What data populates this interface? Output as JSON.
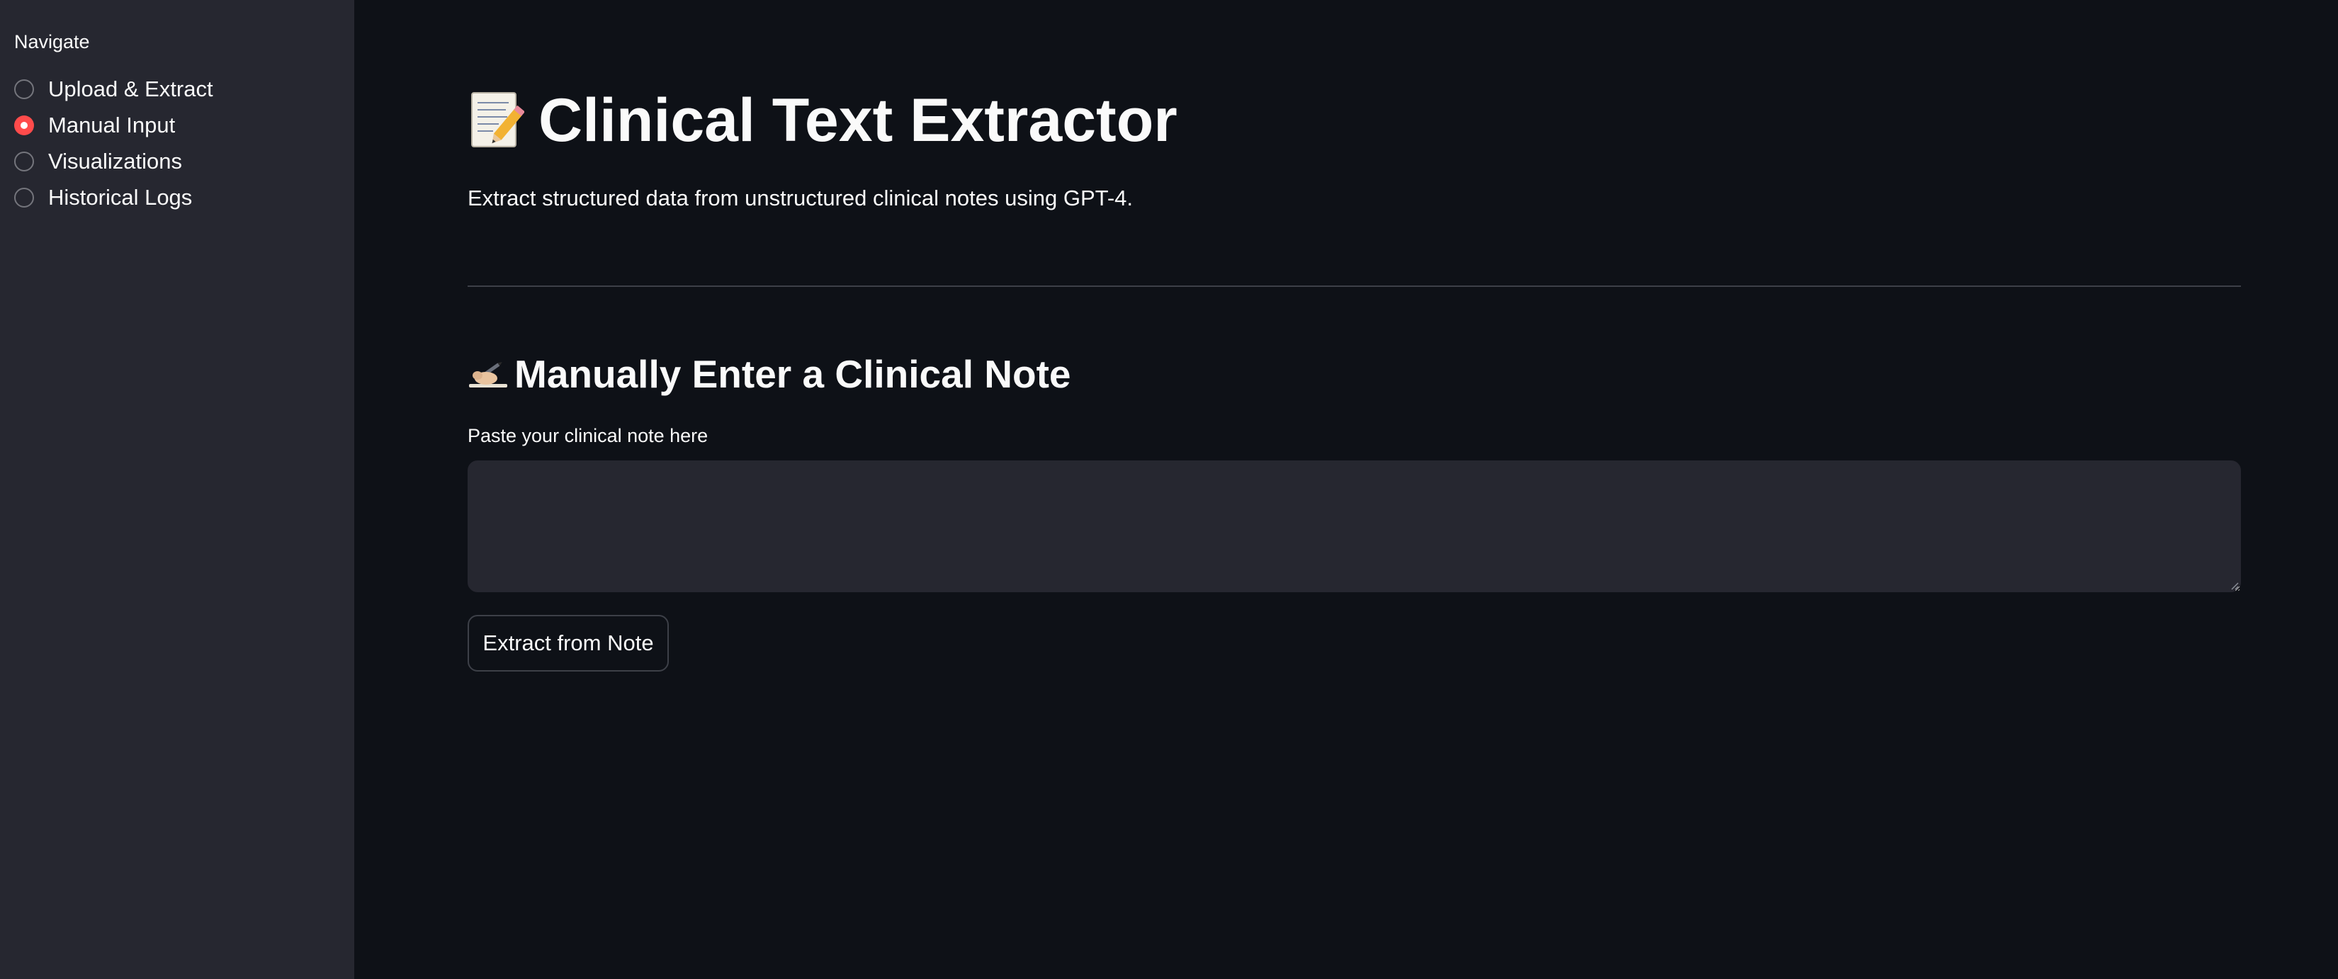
{
  "sidebar": {
    "nav_label": "Navigate",
    "options": [
      {
        "label": "Upload & Extract",
        "selected": false
      },
      {
        "label": "Manual Input",
        "selected": true
      },
      {
        "label": "Visualizations",
        "selected": false
      },
      {
        "label": "Historical Logs",
        "selected": false
      }
    ]
  },
  "main": {
    "title_icon": "memo-icon",
    "title": "Clinical Text Extractor",
    "subtitle": "Extract structured data from unstructured clinical notes using GPT-4.",
    "section": {
      "icon": "writing-hand-icon",
      "heading": "Manually Enter a Clinical Note",
      "field_label": "Paste your clinical note here",
      "textarea_value": "",
      "button_label": "Extract from Note"
    }
  },
  "colors": {
    "background": "#0e1117",
    "sidebar": "#262730",
    "accent": "#ff4b4b",
    "text": "#fafafa",
    "input_bg": "#262730"
  }
}
